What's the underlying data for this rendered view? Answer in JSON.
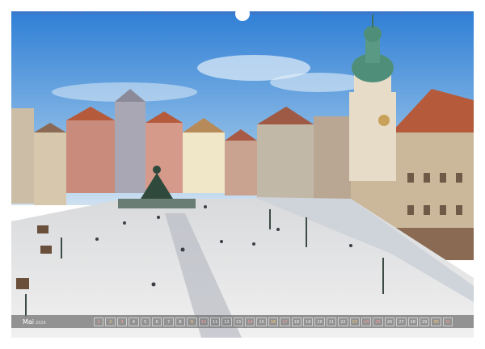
{
  "calendar": {
    "month": "Mai",
    "year": "2026",
    "days": [
      {
        "n": "1",
        "kind": "hol"
      },
      {
        "n": "2",
        "kind": "sat"
      },
      {
        "n": "3",
        "kind": "sun"
      },
      {
        "n": "4",
        "kind": ""
      },
      {
        "n": "5",
        "kind": ""
      },
      {
        "n": "6",
        "kind": ""
      },
      {
        "n": "7",
        "kind": ""
      },
      {
        "n": "8",
        "kind": ""
      },
      {
        "n": "9",
        "kind": "sat"
      },
      {
        "n": "10",
        "kind": "sun"
      },
      {
        "n": "11",
        "kind": ""
      },
      {
        "n": "12",
        "kind": ""
      },
      {
        "n": "13",
        "kind": ""
      },
      {
        "n": "14",
        "kind": "hol"
      },
      {
        "n": "15",
        "kind": ""
      },
      {
        "n": "16",
        "kind": "sat"
      },
      {
        "n": "17",
        "kind": "sun"
      },
      {
        "n": "18",
        "kind": ""
      },
      {
        "n": "19",
        "kind": ""
      },
      {
        "n": "20",
        "kind": ""
      },
      {
        "n": "21",
        "kind": ""
      },
      {
        "n": "22",
        "kind": ""
      },
      {
        "n": "23",
        "kind": "sat"
      },
      {
        "n": "24",
        "kind": "sun"
      },
      {
        "n": "25",
        "kind": "hol"
      },
      {
        "n": "26",
        "kind": ""
      },
      {
        "n": "27",
        "kind": ""
      },
      {
        "n": "28",
        "kind": ""
      },
      {
        "n": "29",
        "kind": ""
      },
      {
        "n": "30",
        "kind": "sat"
      },
      {
        "n": "31",
        "kind": "sun"
      }
    ]
  },
  "colors": {
    "sky_top": "#2f7fd6",
    "sky_bottom": "#bcd7ef",
    "square": "#e9e9ea",
    "tower": "#e6dcc8",
    "tower_dome": "#4f8f7a",
    "roof": "#b55a3a"
  }
}
